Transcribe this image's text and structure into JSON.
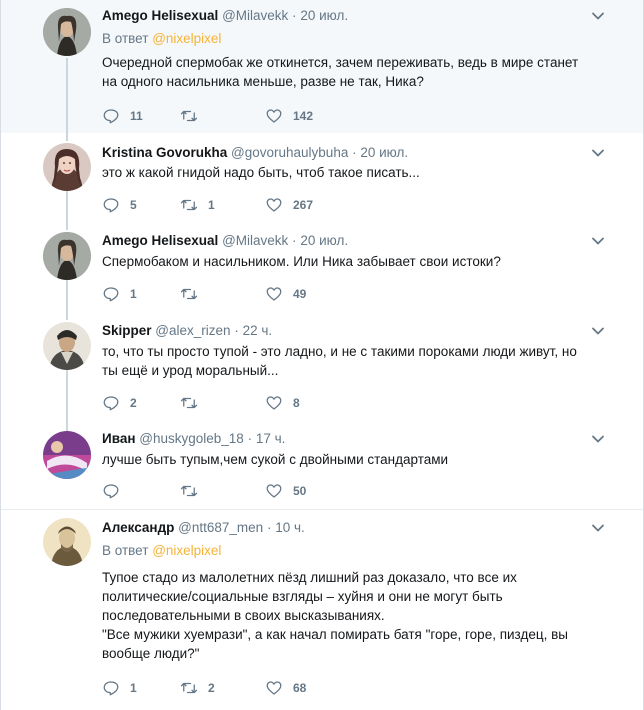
{
  "colors": {
    "accent": "#f5b336",
    "text": "#14171a",
    "muted": "#657786",
    "highlight_bg": "#f5f8fa",
    "thread_line": "#ccd6dd"
  },
  "tweets": [
    {
      "name": "Amego Helisexual",
      "handle": "@Milavekk",
      "dot": "·",
      "time": "20 июл.",
      "reply_prefix": "В ответ",
      "reply_mention": "@nixelpixel",
      "lines": [
        "Очередной спермобак же откинется, зачем переживать, ведь в мире станет",
        "на одного насильника меньше, разве не так, Ника?"
      ],
      "replies": "11",
      "retweets": "",
      "likes": "142",
      "icons": {
        "reply": "reply-icon",
        "retweet": "retweet-icon",
        "like": "heart-icon",
        "menu": "chevron-down-icon"
      }
    },
    {
      "name": "Kristina Govorukha",
      "handle": "@govoruhaulybuha",
      "dot": "·",
      "time": "20 июл.",
      "lines": [
        "это ж какой гнидой надо быть, чтоб такое писать..."
      ],
      "replies": "5",
      "retweets": "1",
      "likes": "267"
    },
    {
      "name": "Amego Helisexual",
      "handle": "@Milavekk",
      "dot": "·",
      "time": "20 июл.",
      "lines": [
        "Спермобаком и насильником. Или Ника забывает свои истоки?"
      ],
      "replies": "1",
      "retweets": "",
      "likes": "49"
    },
    {
      "name": "Skipper",
      "handle": "@alex_rizen",
      "dot": "·",
      "time": "22 ч.",
      "lines": [
        "то, что ты просто тупой - это ладно, и не с такими пороками люди живут, но",
        "ты ещё и урод моральный..."
      ],
      "replies": "2",
      "retweets": "",
      "likes": "8"
    },
    {
      "name": "Иван",
      "handle": "@huskygoleb_18",
      "dot": "·",
      "time": "17 ч.",
      "lines": [
        "лучше быть тупым,чем сукой с двойными стандартами"
      ],
      "replies": "",
      "retweets": "",
      "likes": "50"
    },
    {
      "name": "Александр",
      "handle": "@ntt687_men",
      "dot": "·",
      "time": "10 ч.",
      "reply_prefix": "В ответ",
      "reply_mention": "@nixelpixel",
      "lines": [
        "Тупое стадо из малолетних пёзд лишний раз доказало, что все их",
        "политические/социальные взгляды – хуйня и они не могут быть",
        "последовательными в своих высказываниях.",
        "\"Все мужики хуемрази\", а как начал помирать батя \"горе, горе, пиздец, вы",
        "вообще люди?\""
      ],
      "replies": "1",
      "retweets": "2",
      "likes": "68"
    }
  ]
}
